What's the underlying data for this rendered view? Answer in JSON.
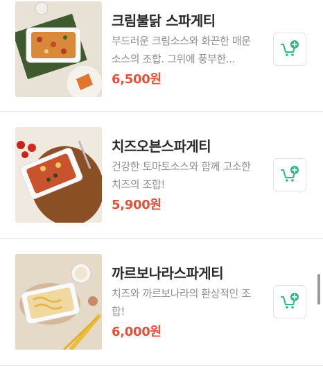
{
  "menu": {
    "items": [
      {
        "name": "크림불닭 스파게티",
        "description": "부드러운 크림소스와 화끈한 매운소스의 조합. 그위에 풍부한...",
        "price": "6,500원",
        "image_icon": "creamy-buldak-spaghetti-dish-icon"
      },
      {
        "name": "치즈오븐스파게티",
        "description": "건강한 토마토소스와 함께 고소한 치즈의 조합!",
        "price": "5,900원",
        "image_icon": "cheese-oven-spaghetti-dish-icon"
      },
      {
        "name": "까르보나라스파게티",
        "description": "치즈와 까르보나라의 환상적인 조합!",
        "price": "6,000원",
        "image_icon": "carbonara-spaghetti-dish-icon"
      }
    ],
    "cart_button_icon": "add-to-cart-icon"
  },
  "colors": {
    "price": "#e4513a",
    "cart_icon": "#2bb98a",
    "name": "#2a2a2a",
    "description": "#8e8e8e"
  }
}
